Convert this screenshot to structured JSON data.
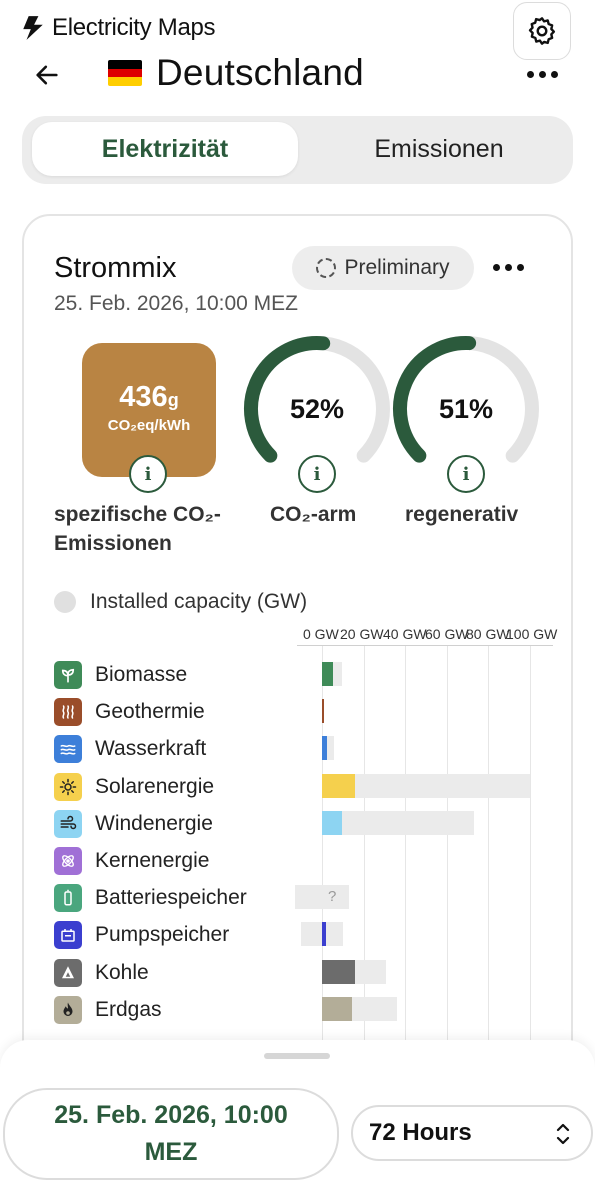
{
  "app": {
    "name": "Electricity Maps",
    "zone_title": "Deutschland",
    "flag_colors": [
      "#000000",
      "#dd0000",
      "#ffce00"
    ]
  },
  "tabs": [
    {
      "label": "Elektrizität",
      "active": true
    },
    {
      "label": "Emissionen",
      "active": false
    }
  ],
  "card": {
    "title": "Strommix",
    "date": "25. Feb. 2026, 10:00 MEZ",
    "badge": "Preliminary"
  },
  "metrics": {
    "intensity": {
      "value": "436",
      "unit_small": "g",
      "unit": "CO₂eq/kWh",
      "label_line1": "spezifische CO₂-",
      "label_line2": "Emissionen",
      "color": "#b98443"
    },
    "low_carbon": {
      "value": "52%",
      "fraction": 0.52,
      "label": "CO₂-arm"
    },
    "renewable": {
      "value": "51%",
      "fraction": 0.51,
      "label": "regenerativ"
    },
    "gauge_color": "#2b5a3c",
    "gauge_track_color": "#e3e3e3"
  },
  "legend": {
    "label": "Installed capacity (GW)"
  },
  "axis": {
    "ticks": [
      "0 GW",
      "20 GW",
      "40 GW",
      "60 GW",
      "80 GW",
      "100 GW"
    ],
    "range": [
      0,
      100
    ]
  },
  "chart_data": {
    "type": "bar",
    "categories": [
      "Biomasse",
      "Geothermie",
      "Wasserkraft",
      "Solarenergie",
      "Windenergie",
      "Kernenergie",
      "Batteriespeicher",
      "Pumpspeicher",
      "Kohle",
      "Erdgas"
    ],
    "series": [
      {
        "values": [
          5.5,
          0.2,
          2.4,
          16,
          9.5,
          0,
          0,
          2,
          16,
          14.5
        ],
        "colors": [
          "#3f8b58",
          "#9a4d2a",
          "#3d7fd9",
          "#f5d04d",
          "#8dd4f2",
          "#a070d6",
          "#4aa67e",
          "#3b3fcf",
          "#6c6c6c",
          "#b3ad98"
        ]
      },
      {
        "name": "Installed capacity (GW)",
        "values": [
          9.5,
          0.3,
          6,
          100,
          73,
          0,
          13,
          10,
          31,
          36
        ]
      }
    ],
    "storage_discharge_min": {
      "Batteriespeicher": -13,
      "Pumpspeicher": -10
    },
    "unknown_marker": {
      "Batteriespeicher": "?"
    },
    "xlim": [
      -13,
      100
    ],
    "grid": true
  },
  "sources": [
    {
      "label": "Biomasse",
      "icon": "leaf-icon",
      "color": "#3f8b58"
    },
    {
      "label": "Geothermie",
      "icon": "heat-waves-icon",
      "color": "#9a4d2a"
    },
    {
      "label": "Wasserkraft",
      "icon": "water-waves-icon",
      "color": "#3d7fd9"
    },
    {
      "label": "Solarenergie",
      "icon": "sun-icon",
      "color": "#f5d04d"
    },
    {
      "label": "Windenergie",
      "icon": "wind-icon",
      "color": "#8dd4f2"
    },
    {
      "label": "Kernenergie",
      "icon": "atom-icon",
      "color": "#a070d6"
    },
    {
      "label": "Batteriespeicher",
      "icon": "battery-icon",
      "color": "#4aa67e"
    },
    {
      "label": "Pumpspeicher",
      "icon": "pump-icon",
      "color": "#3b3fcf"
    },
    {
      "label": "Kohle",
      "icon": "coal-icon",
      "color": "#6c6c6c"
    },
    {
      "label": "Erdgas",
      "icon": "gas-flame-icon",
      "color": "#b3ad98"
    }
  ],
  "footer": {
    "date_line1": "25. Feb. 2026, 10:00",
    "date_line2": "MEZ",
    "range": "72 Hours"
  }
}
